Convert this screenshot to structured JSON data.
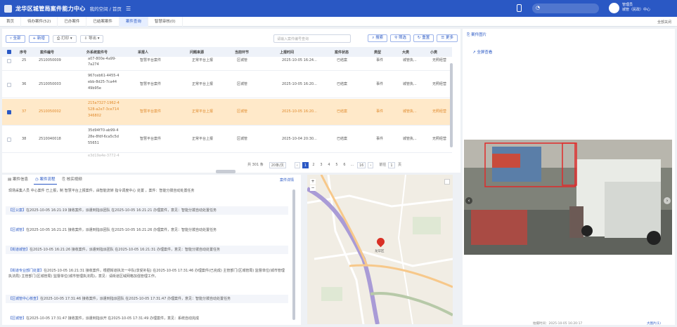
{
  "header": {
    "app_title": "龙华区城管局案件能力中心",
    "breadcrumb": "我的空间 / 首页",
    "user_line1": "管理员",
    "user_line2": "城管（民政）中心"
  },
  "tabs": [
    {
      "label": "首页",
      "active": false
    },
    {
      "label": "待办案件(52)",
      "active": false
    },
    {
      "label": "已办案件",
      "active": false
    },
    {
      "label": "已结案案件",
      "active": false
    },
    {
      "label": "案件查询",
      "active": true
    },
    {
      "label": "智慧审核(0)",
      "active": false
    }
  ],
  "close_all_label": "全部关闭",
  "toolbar": {
    "buttons": [
      "全部",
      "新增",
      "打印",
      "导出"
    ],
    "search_placeholder": "请输入案件编号查询",
    "right_buttons": [
      "搜索",
      "筛选",
      "重置",
      "更多"
    ]
  },
  "table": {
    "columns": [
      "序号",
      "案件编号",
      "外系统案件号",
      "采报人",
      "问题来源",
      "当前环节",
      "上报时间",
      "案件状态",
      "类型",
      "大类",
      "小类"
    ],
    "rows": [
      {
        "seq": "25",
        "no": "2510050009",
        "ext": [
          "a07-800e-4a99-",
          "7a274"
        ],
        "reporter": "智慧平台案件",
        "source": "正常平台上报",
        "node": "区城管",
        "time": "2025-10-05 16:24...",
        "status": "已结案",
        "type": "事件",
        "cat": "城管执...",
        "sub": "无照经营",
        "selected": false
      },
      {
        "seq": "36",
        "no": "2510050003",
        "ext": [
          "967ceb61-4455-4",
          "ebb-8d25-7ca44",
          "49b95e"
        ],
        "reporter": "智慧平台案件",
        "source": "正常平台上报",
        "node": "区城管",
        "time": "2025-10-05 16:20...",
        "status": "已结案",
        "type": "事件",
        "cat": "城管执...",
        "sub": "无照经营",
        "selected": false
      },
      {
        "seq": "37",
        "no": "2510050002",
        "ext": [
          "215a7327-1962-4",
          "528-a2e7-3ce714",
          "346802"
        ],
        "reporter": "智慧平台案件",
        "source": "正常平台上报",
        "node": "区城管",
        "time": "2025-10-05 16:20...",
        "status": "已结案",
        "type": "事件",
        "cat": "城管执...",
        "sub": "无照经营",
        "selected": true
      },
      {
        "seq": "38",
        "no": "2510040018",
        "ext": [
          "35d94f70-ab99-4",
          "28e-8fdf-6ca5c5d",
          "55651"
        ],
        "reporter": "智慧平台案件",
        "source": "正常平台上报",
        "node": "区城管",
        "time": "2025-10-04 20:30...",
        "status": "已结案",
        "type": "事件",
        "cat": "城管执...",
        "sub": "无照经营",
        "selected": false
      },
      {
        "seq": "",
        "no": "",
        "ext": [
          "e3d19a4e-3772-4"
        ],
        "reporter": "",
        "source": "",
        "node": "",
        "time": "",
        "status": "",
        "type": "",
        "cat": "",
        "sub": "",
        "selected": false
      }
    ]
  },
  "pager": {
    "total": "共 301 条",
    "page_size": "20条/页",
    "pages": [
      "1",
      "2",
      "3",
      "4",
      "5",
      "6",
      "...",
      "16"
    ],
    "current_page": "1",
    "goto_label": "前往",
    "goto_value": "1",
    "page_suffix": "页"
  },
  "bottom_tabs": [
    {
      "label": "案件信息",
      "active": false
    },
    {
      "label": "案件流程",
      "active": true
    },
    {
      "label": "核实视频",
      "active": false
    }
  ],
  "flow_link": "案件详情",
  "flow_logs": [
    {
      "tag": "",
      "text": "现场采集人员 中心案件 已上报，制 智慧平台上报案件，由智能流转 指令调度中心 处置 ，案件：智能分拨自动处置任务"
    },
    {
      "tag": "【区公案】",
      "text": "在2025-10-05 16:21:19 接收案件，派遣到指派团队 在2025-10-05 16:21:21 办理案件，意见：智能分拨自动处置任务"
    },
    {
      "tag": "【区城管】",
      "text": "在2025-10-05 16:21:21 接收案件，派遣到指派团队 在2025-10-05 16:21:26 办理案件，意见：智能分拨自动处置任务"
    },
    {
      "tag": "【街道城管】",
      "text": "在2025-10-05 16:21:26 接收案件，派遣到指派团队 在2025-10-05 16:21:31 办理案件，意见：智能分拨自动处置任务"
    },
    {
      "tag": "【街道专业部门处置】",
      "text": "在2025-10-05 16:21:31 接收案件，根据街道执法一中队(享受补贴) 在2025-10-05 17:31:46 办理案件(已完成) 主管部门(区城管局) 监督单位(城市管理执法局) 主管部门(区城管局) 监督单位(城市管理执法局)，意见：请街道区域网格加强管理工作。"
    },
    {
      "tag": "【区城管中心核查】",
      "text": "在2025-10-05 17:31:46 接收案件，派遣到指派团队 在2025-10-05 17:31:47 办理案件，意见：智能分拨自动处置任务"
    },
    {
      "tag": "【区城管】",
      "text": "在2025-10-05 17:31:47 接收案件，派遣到指派开 在2025-10-05 17:31:49 办理案件，意见：系统自动完成"
    }
  ],
  "right_panel": {
    "tab_label": "案件图片",
    "sub_link": "全屏查看",
    "footer_left": "拍摄时间：2025-10-05 16:20:17",
    "footer_right": "大图片(1)"
  },
  "map": {
    "marker_label": "龙华区",
    "accent": "#d93025"
  },
  "colors": {
    "header_bg": "#2a58c4",
    "selected_row": "#ffe9c9",
    "accent": "#2a58c4"
  }
}
